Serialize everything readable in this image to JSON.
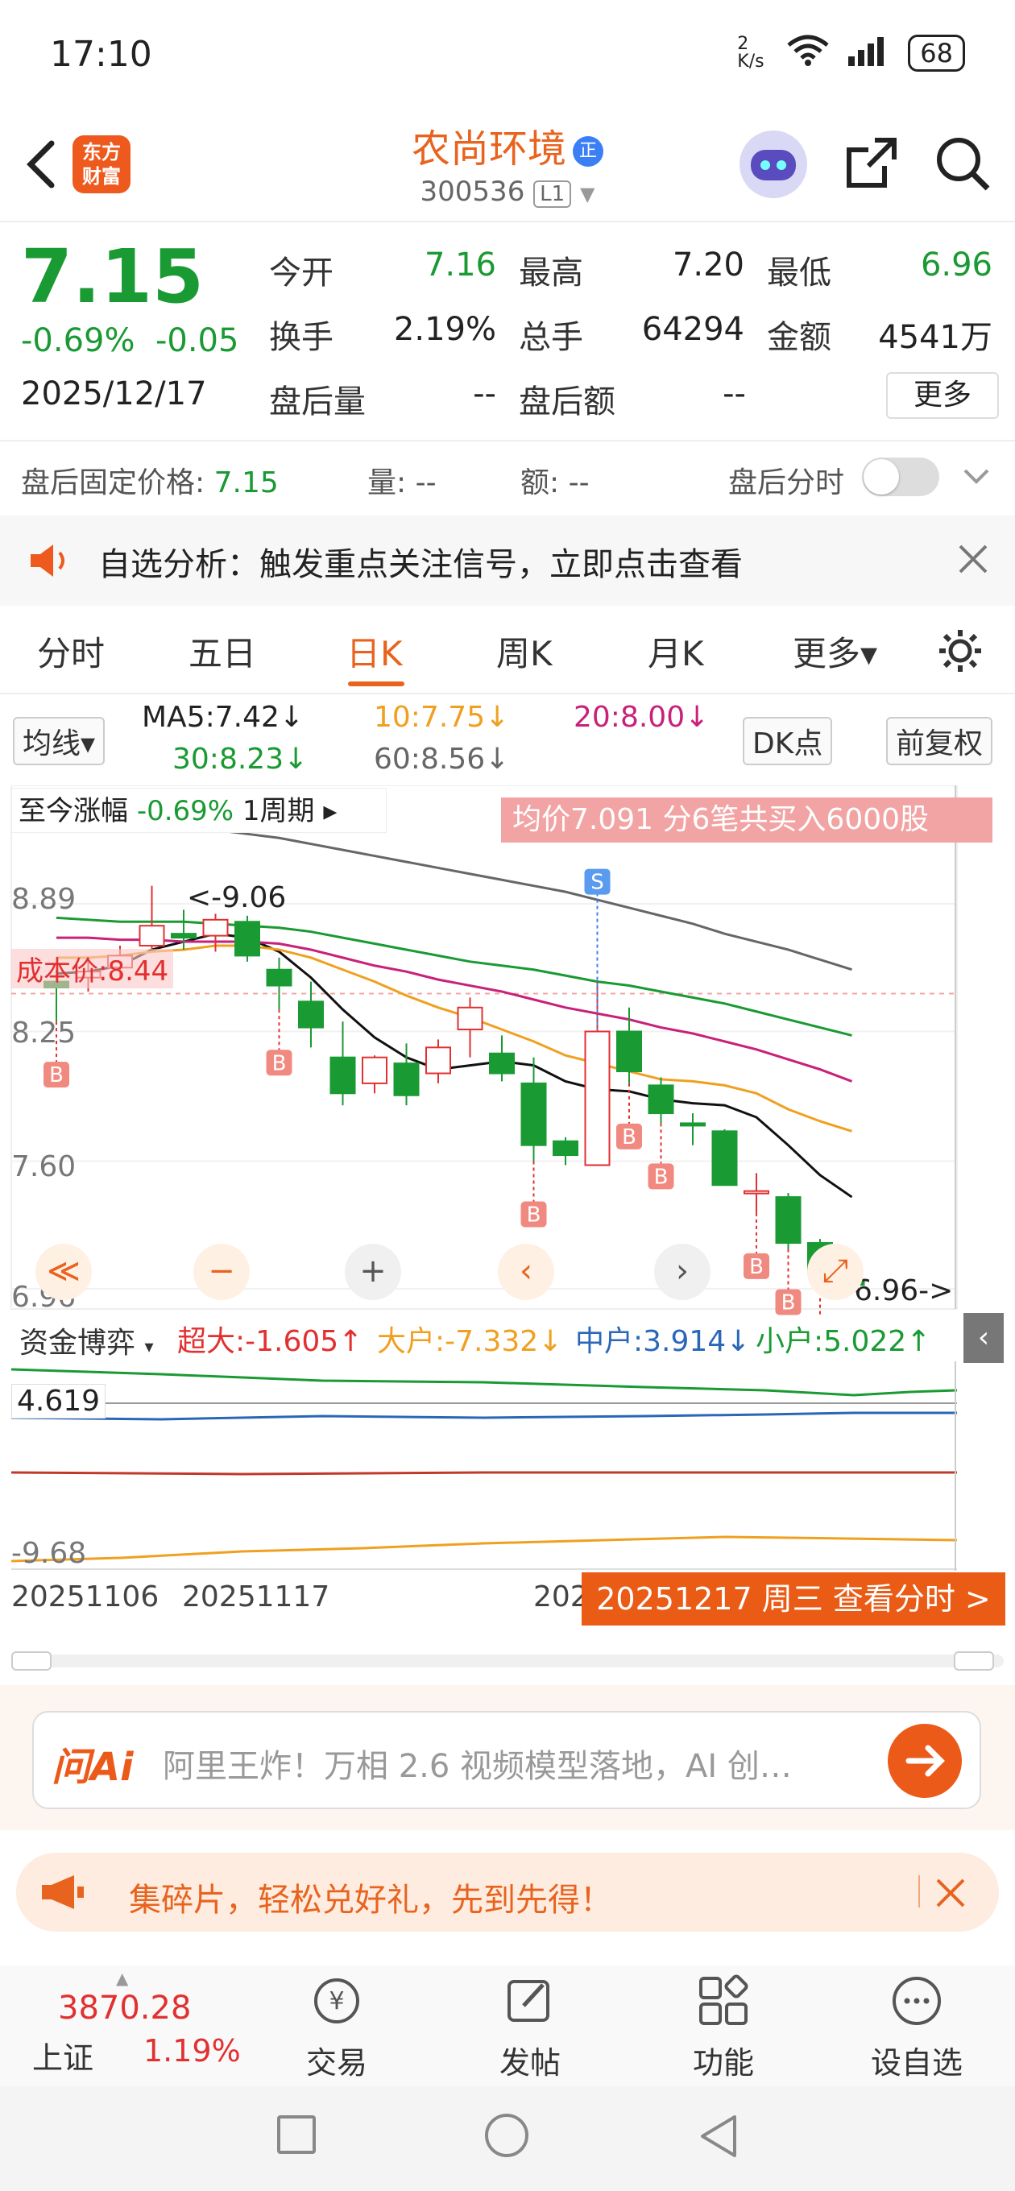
{
  "status": {
    "time": "17:10",
    "net_speed": "2 K/s",
    "battery": "68"
  },
  "header": {
    "name": "农尚环境",
    "badge": "正",
    "code": "300536",
    "level": "L1"
  },
  "quote": {
    "price": "7.15",
    "change_pct": "-0.69%",
    "change": "-0.05",
    "date": "2025/12/17",
    "fields": [
      {
        "label": "今开",
        "value": "7.16",
        "color": "green"
      },
      {
        "label": "最高",
        "value": "7.20",
        "color": "plain"
      },
      {
        "label": "最低",
        "value": "6.96",
        "color": "green"
      },
      {
        "label": "换手",
        "value": "2.19%",
        "color": "plain"
      },
      {
        "label": "总手",
        "value": "64294",
        "color": "plain"
      },
      {
        "label": "金额",
        "value": "4541万",
        "color": "plain"
      },
      {
        "label": "盘后量",
        "value": "--",
        "color": "plain"
      },
      {
        "label": "盘后额",
        "value": "--",
        "color": "plain"
      }
    ],
    "more": "更多"
  },
  "afterhours": {
    "fixed_label": "盘后固定价格:",
    "fixed_value": "7.15",
    "vol": "量: --",
    "amt": "额: --",
    "timeshare": "盘后分时"
  },
  "notice": {
    "text": "自选分析：触发重点关注信号，立即点击查看"
  },
  "tabs": [
    "分时",
    "五日",
    "日K",
    "周K",
    "月K",
    "更多▾"
  ],
  "ma": {
    "type": "均线▾",
    "ma5": "MA5:7.42↓",
    "ma10": "10:7.75↓",
    "ma20": "20:8.00↓",
    "ma30": "30:8.23↓",
    "ma60": "60:8.56↓",
    "dk": "DK点",
    "adjust": "前复权"
  },
  "chart_header": {
    "since_label": "至今涨幅",
    "since_value": "-0.69%",
    "period": "1周期 ▸",
    "avg_banner": "均价7.091  分6笔共买入6000股"
  },
  "chart_labels": {
    "y_top": "8.89",
    "y_mid": "8.25",
    "y_low": "7.60",
    "y_min": "6.96",
    "high_mark": "<-9.06",
    "low_mark": "6.96->",
    "cost_label": "成本价:8.44"
  },
  "chart_data": {
    "type": "candlestick",
    "y_ticks": [
      8.89,
      8.25,
      7.6,
      6.96
    ],
    "candles": [
      {
        "o": 8.5,
        "c": 8.47,
        "h": 8.56,
        "l": 8.3
      },
      {
        "o": 8.52,
        "c": 8.55,
        "h": 8.62,
        "l": 8.45
      },
      {
        "o": 8.57,
        "c": 8.63,
        "h": 8.68,
        "l": 8.52
      },
      {
        "o": 8.68,
        "c": 8.78,
        "h": 8.98,
        "l": 8.66
      },
      {
        "o": 8.74,
        "c": 8.72,
        "h": 8.86,
        "l": 8.66
      },
      {
        "o": 8.73,
        "c": 8.81,
        "h": 8.84,
        "l": 8.65
      },
      {
        "o": 8.8,
        "c": 8.63,
        "h": 8.83,
        "l": 8.6
      },
      {
        "o": 8.56,
        "c": 8.48,
        "h": 8.62,
        "l": 8.36
      },
      {
        "o": 8.4,
        "c": 8.27,
        "h": 8.5,
        "l": 8.17
      },
      {
        "o": 8.12,
        "c": 7.94,
        "h": 8.3,
        "l": 7.88
      },
      {
        "o": 7.99,
        "c": 8.12,
        "h": 8.13,
        "l": 7.94
      },
      {
        "o": 8.09,
        "c": 7.93,
        "h": 8.19,
        "l": 7.88
      },
      {
        "o": 8.04,
        "c": 8.17,
        "h": 8.21,
        "l": 7.99
      },
      {
        "o": 8.26,
        "c": 8.37,
        "h": 8.42,
        "l": 8.12
      },
      {
        "o": 8.14,
        "c": 8.04,
        "h": 8.23,
        "l": 8.0
      },
      {
        "o": 7.99,
        "c": 7.68,
        "h": 8.12,
        "l": 7.6
      },
      {
        "o": 7.7,
        "c": 7.63,
        "h": 7.72,
        "l": 7.58
      },
      {
        "o": 7.58,
        "c": 8.25,
        "h": 8.5,
        "l": 7.58
      },
      {
        "o": 8.25,
        "c": 8.05,
        "h": 8.37,
        "l": 7.99
      },
      {
        "o": 7.98,
        "c": 7.84,
        "h": 8.02,
        "l": 7.79
      },
      {
        "o": 7.79,
        "c": 7.78,
        "h": 7.84,
        "l": 7.68
      },
      {
        "o": 7.75,
        "c": 7.48,
        "h": 7.76,
        "l": 7.48
      },
      {
        "o": 7.45,
        "c": 7.45,
        "h": 7.54,
        "l": 7.34
      },
      {
        "o": 7.42,
        "c": 7.19,
        "h": 7.44,
        "l": 7.16
      },
      {
        "o": 7.19,
        "c": 7.04,
        "h": 7.21,
        "l": 7.01
      },
      {
        "o": 7.0,
        "c": 6.98,
        "h": 7.02,
        "l": 6.96
      }
    ],
    "ma_lines": [
      {
        "name": "MA5",
        "color": "#111111",
        "values": [
          8.54,
          8.55,
          8.58,
          8.66,
          8.7,
          8.74,
          8.72,
          8.65,
          8.52,
          8.36,
          8.22,
          8.12,
          8.06,
          8.08,
          8.1,
          8.08,
          8.0,
          7.96,
          7.95,
          7.91,
          7.89,
          7.88,
          7.82,
          7.68,
          7.53,
          7.42
        ]
      },
      {
        "name": "MA10",
        "color": "#f0a020",
        "values": [
          8.62,
          8.62,
          8.63,
          8.65,
          8.66,
          8.68,
          8.68,
          8.66,
          8.62,
          8.56,
          8.5,
          8.43,
          8.37,
          8.32,
          8.26,
          8.2,
          8.13,
          8.09,
          8.05,
          8.01,
          8.0,
          7.98,
          7.94,
          7.86,
          7.8,
          7.75
        ]
      },
      {
        "name": "MA20",
        "color": "#c8217a",
        "values": [
          8.72,
          8.72,
          8.71,
          8.71,
          8.7,
          8.7,
          8.7,
          8.69,
          8.66,
          8.62,
          8.58,
          8.55,
          8.51,
          8.48,
          8.45,
          8.41,
          8.37,
          8.34,
          8.31,
          8.27,
          8.24,
          8.2,
          8.16,
          8.11,
          8.06,
          8.0
        ]
      },
      {
        "name": "MA30",
        "color": "#1a9a33",
        "values": [
          8.82,
          8.81,
          8.8,
          8.8,
          8.8,
          8.79,
          8.78,
          8.77,
          8.75,
          8.72,
          8.69,
          8.66,
          8.63,
          8.6,
          8.58,
          8.56,
          8.53,
          8.5,
          8.48,
          8.45,
          8.42,
          8.39,
          8.35,
          8.31,
          8.27,
          8.23
        ]
      },
      {
        "name": "MA60",
        "color": "#666666",
        "values": [
          9.35,
          9.34,
          9.32,
          9.3,
          9.28,
          9.26,
          9.24,
          9.22,
          9.19,
          9.16,
          9.13,
          9.1,
          9.07,
          9.04,
          9.01,
          8.98,
          8.95,
          8.91,
          8.87,
          8.83,
          8.79,
          8.74,
          8.7,
          8.66,
          8.61,
          8.56
        ]
      }
    ],
    "buy_markers": [
      0,
      7,
      15,
      18,
      19,
      22,
      23,
      24
    ],
    "sell_markers": [
      17
    ]
  },
  "controls": [
    "≪",
    "−",
    "+",
    "‹",
    "›",
    "⤢"
  ],
  "fund": {
    "label": "资金博弈",
    "super": "超大:-1.605↑",
    "big": "大户:-7.332↓",
    "mid": "中户:3.914↓",
    "small": "小户:5.022↑",
    "y_top": "4.619",
    "y_bottom": "-9.68"
  },
  "x_axis": {
    "start": "20251106",
    "second": "20251117",
    "partial": "202"
  },
  "view_button": "20251217 周三 查看分时 >",
  "ai": {
    "logo": "问Ai",
    "text": "阿里王炸！万相 2.6 视频模型落地，AI 创…"
  },
  "promo": {
    "text": "集碎片，轻松兑好礼，先到先得！"
  },
  "bottom_nav": {
    "index_value": "3870.28",
    "index_name": "上证",
    "index_pct": "1.19%",
    "items": [
      "交易",
      "发帖",
      "功能",
      "设自选"
    ]
  }
}
